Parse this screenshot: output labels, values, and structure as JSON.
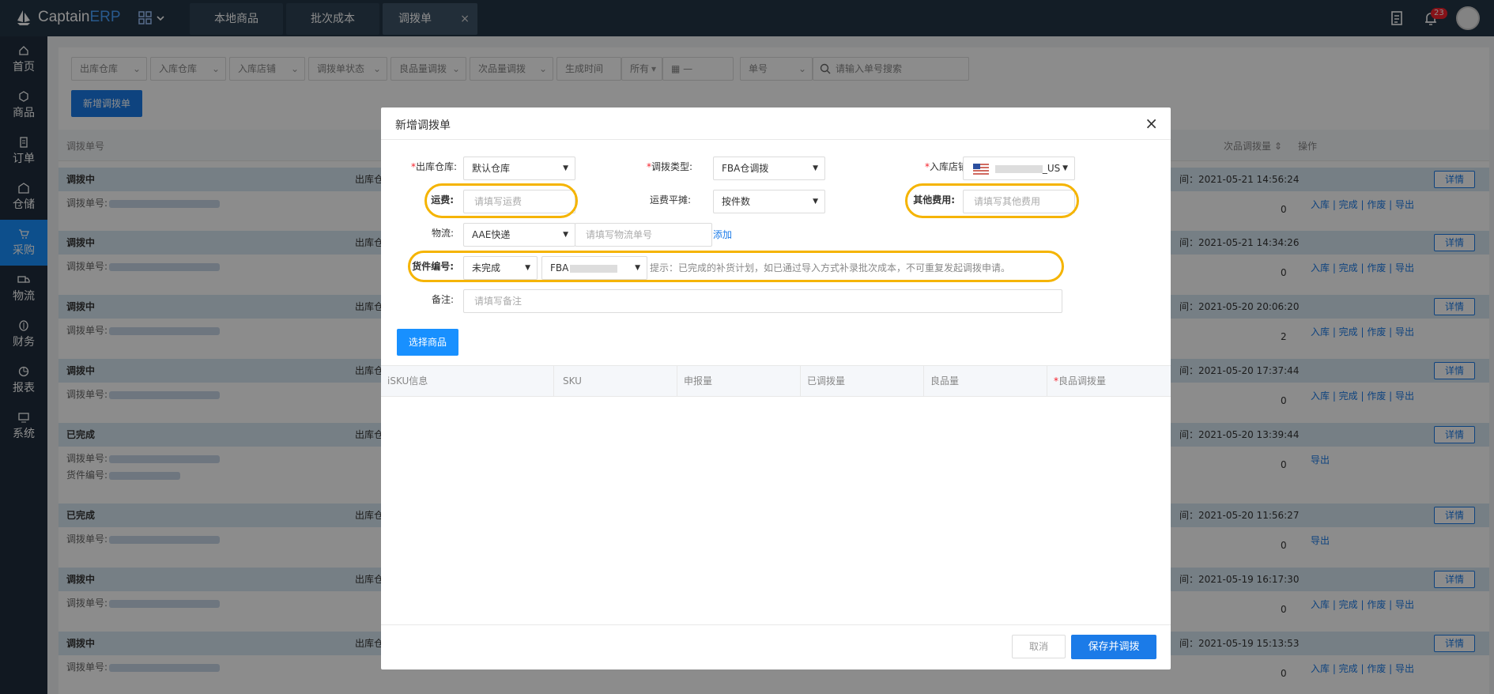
{
  "app": {
    "brand_a": "Captain",
    "brand_b": "ERP",
    "notification_count": "23"
  },
  "tabs": [
    {
      "label": "本地商品"
    },
    {
      "label": "批次成本"
    },
    {
      "label": "调拨单",
      "close": "×"
    }
  ],
  "sidebar": {
    "items": [
      {
        "label": "首页",
        "icon": "home-icon"
      },
      {
        "label": "商品",
        "icon": "box-icon"
      },
      {
        "label": "订单",
        "icon": "order-icon"
      },
      {
        "label": "仓储",
        "icon": "warehouse-icon"
      },
      {
        "label": "采购",
        "icon": "cart-icon",
        "active": true
      },
      {
        "label": "物流",
        "icon": "truck-icon"
      },
      {
        "label": "财务",
        "icon": "finance-icon"
      },
      {
        "label": "报表",
        "icon": "report-icon"
      },
      {
        "label": "系统",
        "icon": "system-icon"
      }
    ]
  },
  "filters": {
    "out_wh": "出库仓库",
    "in_wh": "入库仓库",
    "in_shop": "入库店铺",
    "status": "调拨单状态",
    "good_qty": "良品量调拨",
    "bad_qty": "次品量调拨",
    "created": "生成时间",
    "all": "所有",
    "dash": "—",
    "order_no": "单号",
    "search_placeholder": "请输入单号搜索"
  },
  "new_button": "新增调拨单",
  "list": {
    "col_order": "调拨单号",
    "col_bad": "次品调拨量",
    "col_ops": "操作",
    "rows": [
      {
        "status": "调拨中",
        "wh": "出库仓",
        "date": "间：2021-05-21 14:56:24",
        "qty": "0",
        "ops": "入库 | 完成 | 作废 | 导出",
        "no_label": "调拨单号:"
      },
      {
        "status": "调拨中",
        "wh": "出库仓",
        "date": "间：2021-05-21 14:34:26",
        "qty": "0",
        "ops": "入库 | 完成 | 作废 | 导出",
        "no_label": "调拨单号:"
      },
      {
        "status": "调拨中",
        "wh": "出库仓",
        "date": "间：2021-05-20 20:06:20",
        "qty": "2",
        "ops": "入库 | 完成 | 作废 | 导出",
        "no_label": "调拨单号:"
      },
      {
        "status": "调拨中",
        "wh": "出库仓",
        "date": "间：2021-05-20 17:37:44",
        "qty": "0",
        "ops": "入库 | 完成 | 作废 | 导出",
        "no_label": "调拨单号:"
      },
      {
        "status": "已完成",
        "wh": "出库仓",
        "date": "间：2021-05-20 13:39:44",
        "qty": "0",
        "ops": "导出",
        "no_label": "调拨单号:",
        "no2_label": "货件编号:"
      },
      {
        "status": "已完成",
        "wh": "出库仓",
        "date": "间：2021-05-20 11:56:27",
        "qty": "0",
        "ops": "导出",
        "no_label": "调拨单号:"
      },
      {
        "status": "调拨中",
        "wh": "出库仓",
        "date": "间：2021-05-19 16:17:30",
        "qty": "0",
        "ops": "入库 | 完成 | 作废 | 导出",
        "no_label": "调拨单号:"
      },
      {
        "status": "调拨中",
        "wh": "出库仓",
        "date": "间：2021-05-19 15:13:53",
        "qty": "0",
        "ops": "入库 | 完成 | 作废 | 导出",
        "no_label": "调拨单号:"
      }
    ],
    "detail": "详情"
  },
  "modal": {
    "title": "新增调拨单",
    "close": "×",
    "out_wh_label": "出库仓库:",
    "out_wh_value": "默认仓库",
    "type_label": "调拨类型:",
    "type_value": "FBA仓调拨",
    "shop_label": "入库店铺:",
    "shop_value": "_US",
    "freight_label": "运费:",
    "freight_placeholder": "请填写运费",
    "alloc_label": "运费平摊:",
    "alloc_value": "按件数",
    "other_label": "其他费用:",
    "other_placeholder": "请填写其他费用",
    "logistics_label": "物流:",
    "logistics_value": "AAE快递",
    "tracking_placeholder": "请填写物流单号",
    "add_link": "添加",
    "shipment_label": "货件编号:",
    "shipment_status": "未完成",
    "shipment_value": "FBA",
    "hint": "提示：已完成的补货计划，如已通过导入方式补录批次成本，不可重复发起调拨申请。",
    "remark_label": "备注:",
    "remark_placeholder": "请填写备注",
    "select_goods": "选择商品",
    "columns": [
      "iSKU信息",
      "SKU",
      "申报量",
      "已调拨量",
      "良品量",
      "良品调拨量"
    ],
    "cancel": "取消",
    "save": "保存并调拨"
  }
}
